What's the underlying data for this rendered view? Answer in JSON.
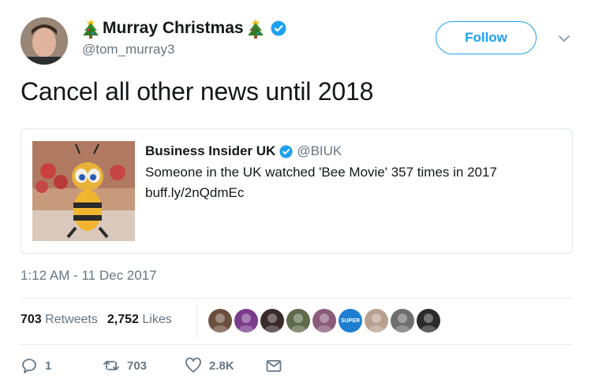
{
  "user": {
    "display_name": "Murray Christmas",
    "handle": "@tom_murray3",
    "emoji": "christmas-tree",
    "verified": true
  },
  "header": {
    "follow_label": "Follow"
  },
  "tweet": {
    "text": "Cancel all other news until 2018",
    "timestamp": "1:12 AM - 11 Dec 2017"
  },
  "quoted": {
    "name": "Business Insider UK",
    "handle": "@BIUK",
    "text": "Someone in the UK watched 'Bee Movie' 357 times in 2017",
    "link": "buff.ly/2nQdmEc",
    "verified": true
  },
  "stats": {
    "retweets_count": "703",
    "retweets_label": "Retweets",
    "likes_count": "2,752",
    "likes_label": "Likes"
  },
  "likers": [
    {
      "color": "#6b4e3d"
    },
    {
      "color": "#7a3c8a"
    },
    {
      "color": "#3a2a2a"
    },
    {
      "color": "#5d6b4a"
    },
    {
      "color": "#8a5a7a"
    },
    {
      "color": "#1e7fd0",
      "text": "SUPER"
    },
    {
      "color": "#b8a090"
    },
    {
      "color": "#6e6e6e"
    },
    {
      "color": "#2b2b2b"
    }
  ],
  "actions": {
    "reply_count": "1",
    "retweet_count": "703",
    "like_count": "2.8K"
  },
  "colors": {
    "accent": "#1da1f2",
    "muted": "#657786",
    "text": "#14171a"
  }
}
